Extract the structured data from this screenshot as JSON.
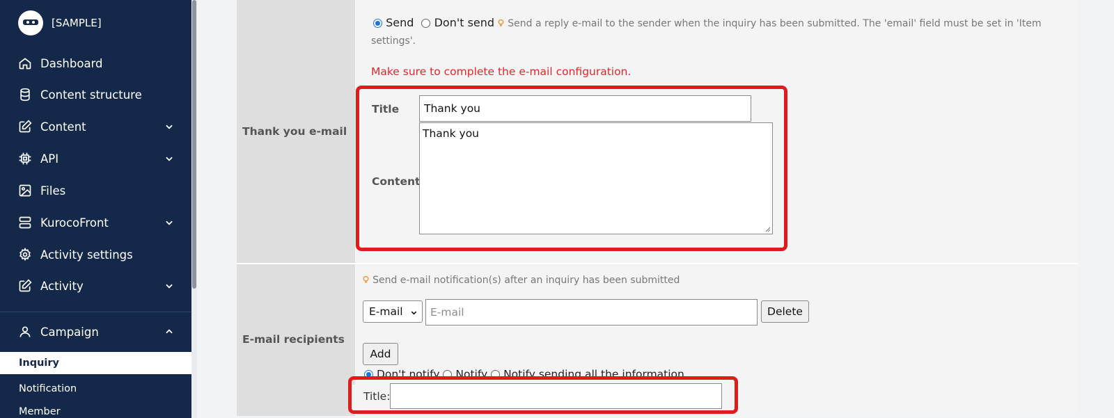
{
  "sidebar": {
    "brand": "[SAMPLE]",
    "items": [
      {
        "label": "Dashboard"
      },
      {
        "label": "Content structure"
      },
      {
        "label": "Content"
      },
      {
        "label": "API"
      },
      {
        "label": "Files"
      },
      {
        "label": "KurocoFront"
      },
      {
        "label": "Activity settings"
      },
      {
        "label": "Activity"
      },
      {
        "label": "Campaign"
      }
    ],
    "submenu": [
      {
        "label": "Inquiry"
      },
      {
        "label": "Notification"
      },
      {
        "label": "Member"
      }
    ]
  },
  "thank_you": {
    "row_label": "Thank you e-mail",
    "send_label": "Send",
    "dont_send_label": "Don't send",
    "hint": "Send a reply e-mail to the sender when the inquiry has been submitted. The 'email' field must be set in 'Item",
    "hint_cont": "settings'.",
    "warning": "Make sure to complete the e-mail configuration.",
    "title_label": "Title",
    "title_value": "Thank you",
    "content_label": "Content",
    "content_value": "Thank you"
  },
  "recipients": {
    "row_label": "E-mail recipients",
    "hint": "Send e-mail notification(s) after an inquiry has been submitted",
    "select_value": "E-mail",
    "email_placeholder": "E-mail",
    "delete_label": "Delete",
    "add_label": "Add",
    "opt_dont_notify": "Don't notify",
    "opt_notify": "Notify",
    "opt_notify_all": "Notify sending all the information",
    "title_label": "Title:",
    "title_value": ""
  },
  "colors": {
    "sidebar_bg": "#14294a",
    "highlight": "#e01b1b",
    "warning_text": "#e5262a",
    "radio_active": "#1a73e8"
  }
}
